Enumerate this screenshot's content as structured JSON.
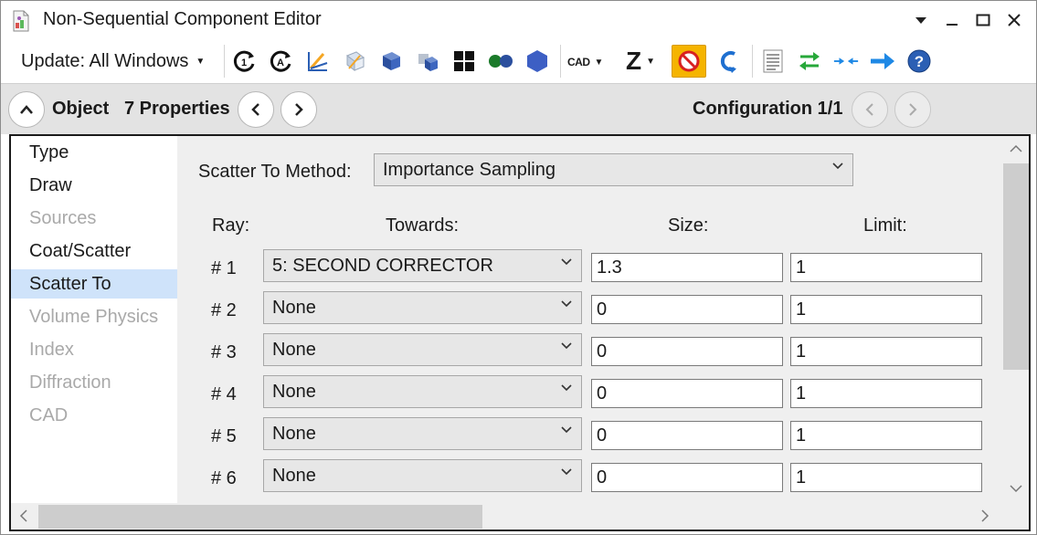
{
  "window": {
    "title": "Non-Sequential Component Editor",
    "app_icon": "zemax-app-icon",
    "controls": [
      "dropdown-icon",
      "minimize-icon",
      "maximize-icon",
      "close-icon"
    ]
  },
  "toolbar": {
    "update_label": "Update: All Windows",
    "cad_label": "CAD",
    "z_label": "Z",
    "icons": [
      "refresh-icon",
      "refresh-all-icon",
      "ray-trace-icon",
      "wireframe-icon",
      "shaded-icon",
      "solid-icon",
      "grid-icon",
      "pair-icon",
      "hexagon-icon",
      "cad-icon",
      "z-icon",
      "stop-icon",
      "undo-icon",
      "report-icon",
      "swap-icon",
      "collapse-icon",
      "next-icon",
      "help-icon"
    ],
    "colors": {
      "accent_blue": "#2b5fb4",
      "stop_orange": "#f5b400",
      "green": "#27a83a",
      "arrow_blue": "#1e88e5"
    }
  },
  "object_bar": {
    "object_label": "Object",
    "properties_label": "7 Properties",
    "configuration_label": "Configuration 1/1"
  },
  "nav": {
    "items": [
      {
        "label": "Type",
        "state": "enabled"
      },
      {
        "label": "Draw",
        "state": "enabled"
      },
      {
        "label": "Sources",
        "state": "disabled"
      },
      {
        "label": "Coat/Scatter",
        "state": "enabled"
      },
      {
        "label": "Scatter To",
        "state": "selected"
      },
      {
        "label": "Volume Physics",
        "state": "disabled"
      },
      {
        "label": "Index",
        "state": "disabled"
      },
      {
        "label": "Diffraction",
        "state": "disabled"
      },
      {
        "label": "CAD",
        "state": "disabled"
      }
    ],
    "selected_color": "#cfe3fa"
  },
  "scatter_to": {
    "method_label": "Scatter To Method:",
    "method_value": "Importance Sampling",
    "headers": {
      "ray": "Ray:",
      "towards": "Towards:",
      "size": "Size:",
      "limit": "Limit:"
    },
    "rows": [
      {
        "ray": "# 1",
        "towards": "5: SECOND CORRECTOR",
        "size": "1.3",
        "limit": "1"
      },
      {
        "ray": "# 2",
        "towards": "None",
        "size": "0",
        "limit": "1"
      },
      {
        "ray": "# 3",
        "towards": "None",
        "size": "0",
        "limit": "1"
      },
      {
        "ray": "# 4",
        "towards": "None",
        "size": "0",
        "limit": "1"
      },
      {
        "ray": "# 5",
        "towards": "None",
        "size": "0",
        "limit": "1"
      },
      {
        "ray": "# 6",
        "towards": "None",
        "size": "0",
        "limit": "1"
      }
    ]
  }
}
